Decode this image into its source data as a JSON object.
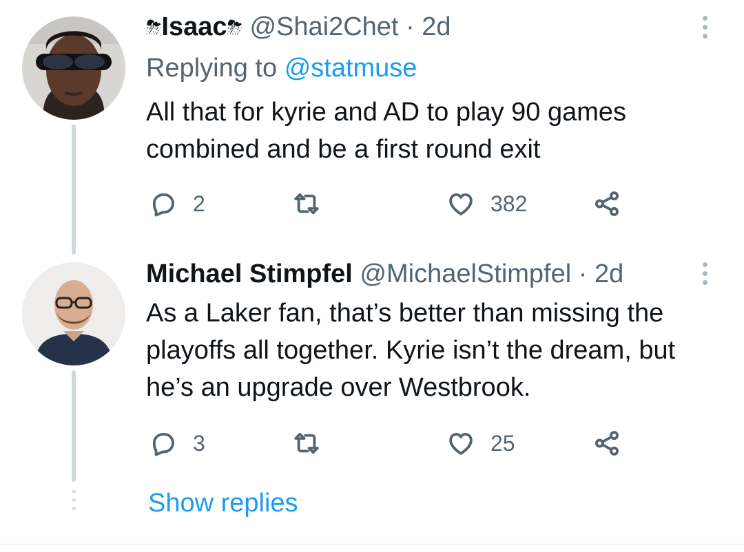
{
  "tweets": [
    {
      "name": "Isaac",
      "name_prefix_emoji": "⛈",
      "name_suffix_emoji": "⛈",
      "handle": "@Shai2Chet",
      "separator": "·",
      "time": "2d",
      "replying_label": "Replying to",
      "replying_to": "@statmuse",
      "text": "All that for kyrie and AD to play 90 games combined and be a first round exit",
      "reply_count": "2",
      "retweet_count": "",
      "like_count": "382"
    },
    {
      "name": "Michael Stimpfel",
      "handle": "@MichaelStimpfel",
      "separator": "·",
      "time": "2d",
      "text": "As a Laker fan, that’s better than missing the playoffs all together. Kyrie isn’t the dream, but he’s an upgrade over Westbrook.",
      "reply_count": "3",
      "retweet_count": "",
      "like_count": "25"
    }
  ],
  "show_replies_label": "Show replies",
  "icons": {
    "reply": "reply-icon",
    "retweet": "retweet-icon",
    "like": "heart-icon",
    "share": "share-icon",
    "more": "more-vertical-icon"
  },
  "colors": {
    "link": "#1d9bf0",
    "text": "#0f1419",
    "secondary": "#536471",
    "thread_line": "#cfd9de"
  }
}
